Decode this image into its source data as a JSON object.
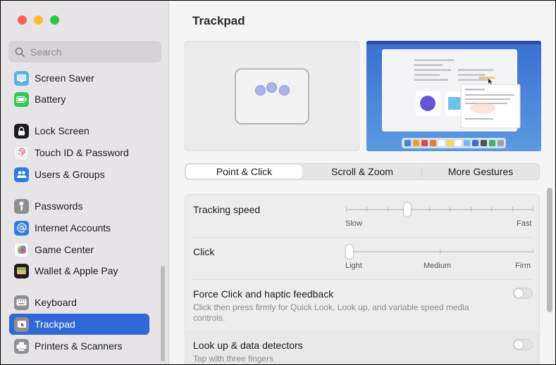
{
  "search": {
    "placeholder": "Search"
  },
  "sidebar": {
    "items": [
      {
        "label": "Screen Saver",
        "icon": "screen-saver-icon",
        "color": "#5ab3e8"
      },
      {
        "label": "Battery",
        "icon": "battery-icon",
        "color": "#35c759"
      },
      {
        "label": "Lock Screen",
        "icon": "lock-icon",
        "color": "#1d1d1f"
      },
      {
        "label": "Touch ID & Password",
        "icon": "fingerprint-icon",
        "color": "#f2f2f2"
      },
      {
        "label": "Users & Groups",
        "icon": "users-icon",
        "color": "#2f7de1"
      },
      {
        "label": "Passwords",
        "icon": "key-icon",
        "color": "#8e8e93"
      },
      {
        "label": "Internet Accounts",
        "icon": "at-icon",
        "color": "#2f7de1"
      },
      {
        "label": "Game Center",
        "icon": "game-center-icon",
        "color": "#ffffff"
      },
      {
        "label": "Wallet & Apple Pay",
        "icon": "wallet-icon",
        "color": "#1d1d1f"
      },
      {
        "label": "Keyboard",
        "icon": "keyboard-icon",
        "color": "#8e8e93"
      },
      {
        "label": "Trackpad",
        "icon": "trackpad-icon",
        "color": "#8e8e93",
        "active": true
      },
      {
        "label": "Printers & Scanners",
        "icon": "printer-icon",
        "color": "#8e8e93"
      }
    ]
  },
  "main": {
    "title": "Trackpad",
    "tabs": [
      {
        "label": "Point & Click",
        "active": true
      },
      {
        "label": "Scroll & Zoom"
      },
      {
        "label": "More Gestures"
      }
    ],
    "settings": {
      "tracking_speed": {
        "label": "Tracking speed",
        "min_label": "Slow",
        "max_label": "Fast",
        "level": 0.33
      },
      "click": {
        "label": "Click",
        "labels": [
          "Light",
          "Medium",
          "Firm"
        ],
        "level": 0.0
      },
      "force_click": {
        "label": "Force Click and haptic feedback",
        "description": "Click then press firmly for Quick Look, Look up, and variable speed media controls.",
        "enabled": false
      },
      "look_up": {
        "label": "Look up & data detectors",
        "description": "Tap with three fingers",
        "enabled": false
      }
    }
  },
  "colors": {
    "accent": "#2f67d7",
    "close": "#ff5f57",
    "minimize": "#febc2e",
    "maximize": "#28c840"
  }
}
